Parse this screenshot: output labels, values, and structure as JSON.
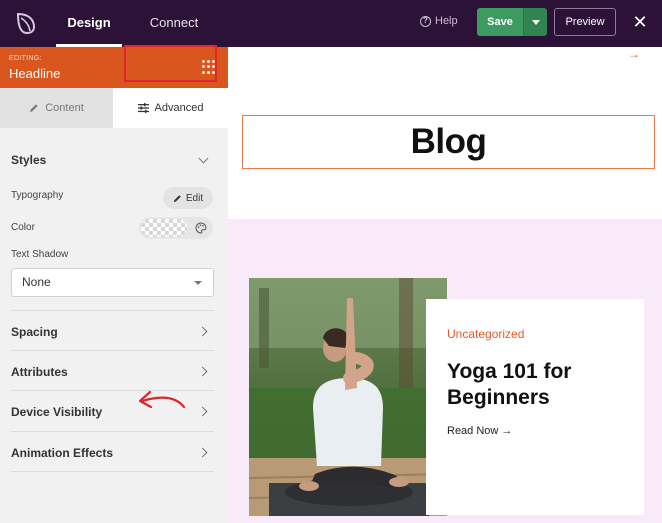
{
  "topbar": {
    "tabs": [
      {
        "label": "Design",
        "active": true
      },
      {
        "label": "Connect",
        "active": false
      }
    ],
    "help_label": "Help",
    "save_label": "Save",
    "preview_label": "Preview",
    "close_icon": "close-icon"
  },
  "panel": {
    "editing_label": "EDITING:",
    "editing_title": "Headline",
    "subtabs": {
      "content_label": "Content",
      "advanced_label": "Advanced"
    },
    "styles": {
      "title": "Styles",
      "typography_label": "Typography",
      "edit_label": "Edit",
      "color_label": "Color",
      "text_shadow_label": "Text Shadow",
      "text_shadow_value": "None"
    },
    "sections": [
      {
        "label": "Spacing"
      },
      {
        "label": "Attributes"
      },
      {
        "label": "Device Visibility"
      },
      {
        "label": "Animation Effects"
      }
    ]
  },
  "preview": {
    "headline": "Blog",
    "card": {
      "category": "Uncategorized",
      "title": "Yoga 101 for Beginners",
      "read_more": "Read Now →"
    }
  },
  "colors": {
    "topbar": "#2b1236",
    "editing_bar": "#d9561f",
    "save": "#3d9b62",
    "accent": "#e05a2a",
    "highlight": "#e0262b",
    "pink_bg": "#f9eafa"
  }
}
